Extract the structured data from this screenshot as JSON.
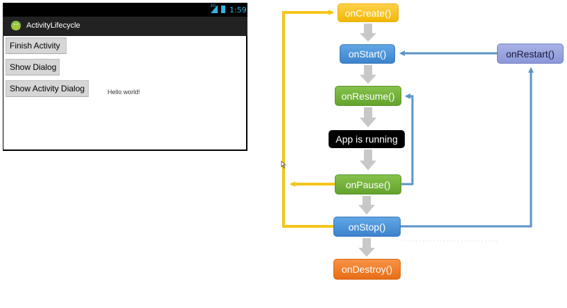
{
  "phone": {
    "status": {
      "network": "3G",
      "clock": "1:59"
    },
    "app_title": "ActivityLifecycle",
    "buttons": {
      "finish_activity": "Finish Activity",
      "show_dialog": "Show Dialog",
      "show_activity_dialog": "Show Activity Dialog"
    },
    "hello_text": "Hello world!"
  },
  "diagram": {
    "nodes": {
      "oncreate": "onCreate()",
      "onstart": "onStart()",
      "onresume": "onResume()",
      "running": "App is running",
      "onpause": "onPause()",
      "onstop": "onStop()",
      "ondestroy": "onDestroy()",
      "onrestart": "onRestart()"
    },
    "colors": {
      "create": "#f2b705",
      "start_stop": "#3c83cc",
      "resume_pause": "#63a32c",
      "running": "#000000",
      "destroy": "#e86e16",
      "restart": "#8b98d8",
      "yellow_arrow": "#f5c518",
      "blue_arrow": "#5b93c7",
      "grey_arrow": "#c8c8c8"
    }
  }
}
